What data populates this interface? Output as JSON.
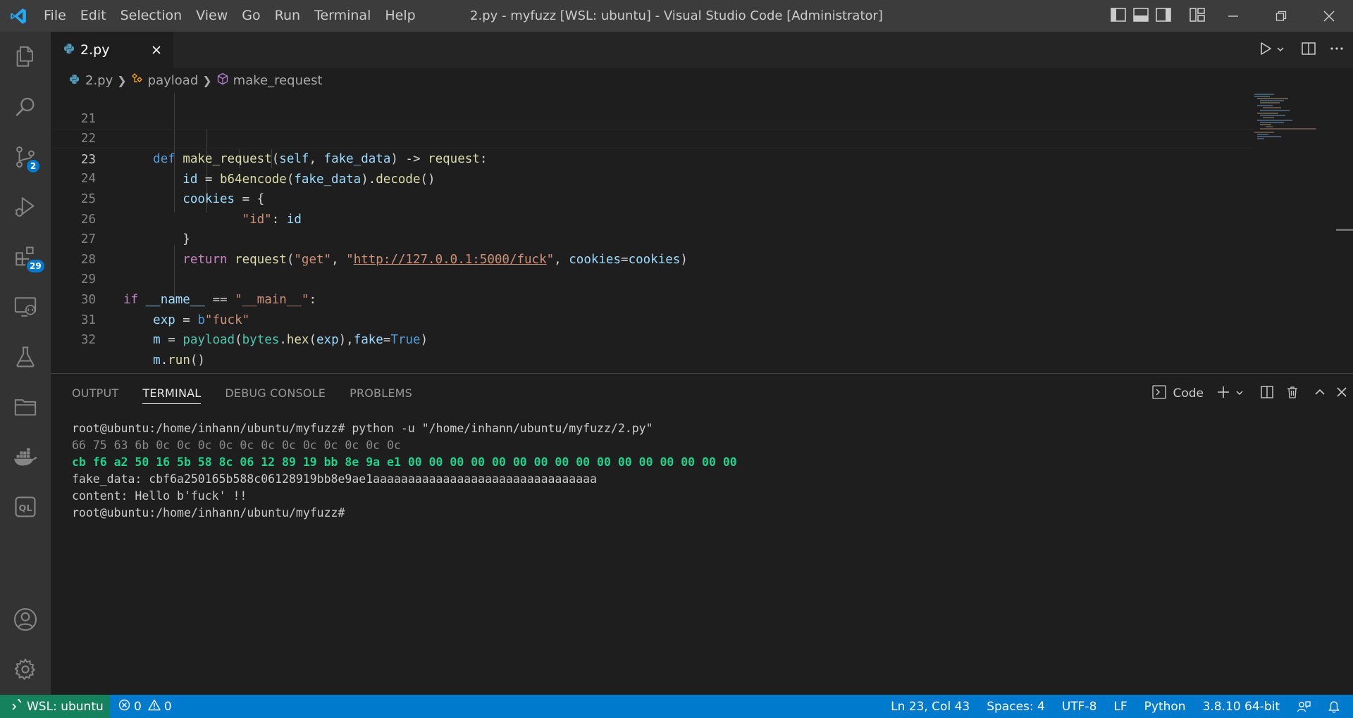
{
  "window": {
    "title": "2.py - myfuzz [WSL: ubuntu] - Visual Studio Code [Administrator]",
    "menu": [
      "File",
      "Edit",
      "Selection",
      "View",
      "Go",
      "Run",
      "Terminal",
      "Help"
    ]
  },
  "activity_bar": {
    "source_control_badge": "2",
    "extensions_badge": "29"
  },
  "tabs": [
    {
      "label": "2.py",
      "active": true
    }
  ],
  "breadcrumb": {
    "file": "2.py",
    "class": "payload",
    "method": "make_request"
  },
  "editor": {
    "lines": [
      {
        "num": "21"
      },
      {
        "num": "22",
        "def": "def",
        "name": "make_request",
        "p1": "self",
        "p2": "fake_data",
        "ret": "request"
      },
      {
        "num": "23",
        "v": "id",
        "fn1": "b64encode",
        "arg": "fake_data",
        "fn2": "decode"
      },
      {
        "num": "24",
        "v": "cookies"
      },
      {
        "num": "25",
        "key": "\"id\"",
        "val": "id"
      },
      {
        "num": "26"
      },
      {
        "num": "27",
        "kw": "return",
        "fn": "request",
        "s1": "\"get\"",
        "q": "\"",
        "url": "http://127.0.0.1:5000/fuck",
        "kwarg": "cookies",
        "val": "cookies"
      },
      {
        "num": "28"
      },
      {
        "num": "29",
        "kw": "if",
        "name": "__name__",
        "s": "\"__main__\""
      },
      {
        "num": "30",
        "v": "exp",
        "prefix": "b",
        "s": "\"fuck\""
      },
      {
        "num": "31",
        "v": "m",
        "fn": "payload",
        "cls": "bytes",
        "m": "hex",
        "arg": "exp",
        "kw": "fake",
        "val": "True"
      },
      {
        "num": "32",
        "v": "m",
        "fn": "run"
      }
    ]
  },
  "panel": {
    "tabs": [
      "OUTPUT",
      "TERMINAL",
      "DEBUG CONSOLE",
      "PROBLEMS"
    ],
    "active_tab": "TERMINAL",
    "terminal_name": "Code",
    "terminal_lines": [
      "root@ubuntu:/home/inhann/ubuntu/myfuzz# python -u \"/home/inhann/ubuntu/myfuzz/2.py\"",
      "66 75 63 6b 0c 0c 0c 0c 0c 0c 0c 0c 0c 0c 0c 0c",
      "cb f6 a2 50 16 5b 58 8c 06 12 89 19 bb 8e 9a e1 00 00 00 00 00 00 00 00 00 00 00 00 00 00 00 00",
      "fake_data: cbf6a250165b588c06128919bb8e9ae1aaaaaaaaaaaaaaaaaaaaaaaaaaaaaaaa",
      "content: Hello b'fuck' !!",
      "root@ubuntu:/home/inhann/ubuntu/myfuzz# "
    ]
  },
  "status_bar": {
    "remote": "WSL: ubuntu",
    "errors": "0",
    "warnings": "0",
    "position": "Ln 23, Col 43",
    "indent": "Spaces: 4",
    "encoding": "UTF-8",
    "eol": "LF",
    "language": "Python",
    "interpreter": "3.8.10 64-bit"
  }
}
